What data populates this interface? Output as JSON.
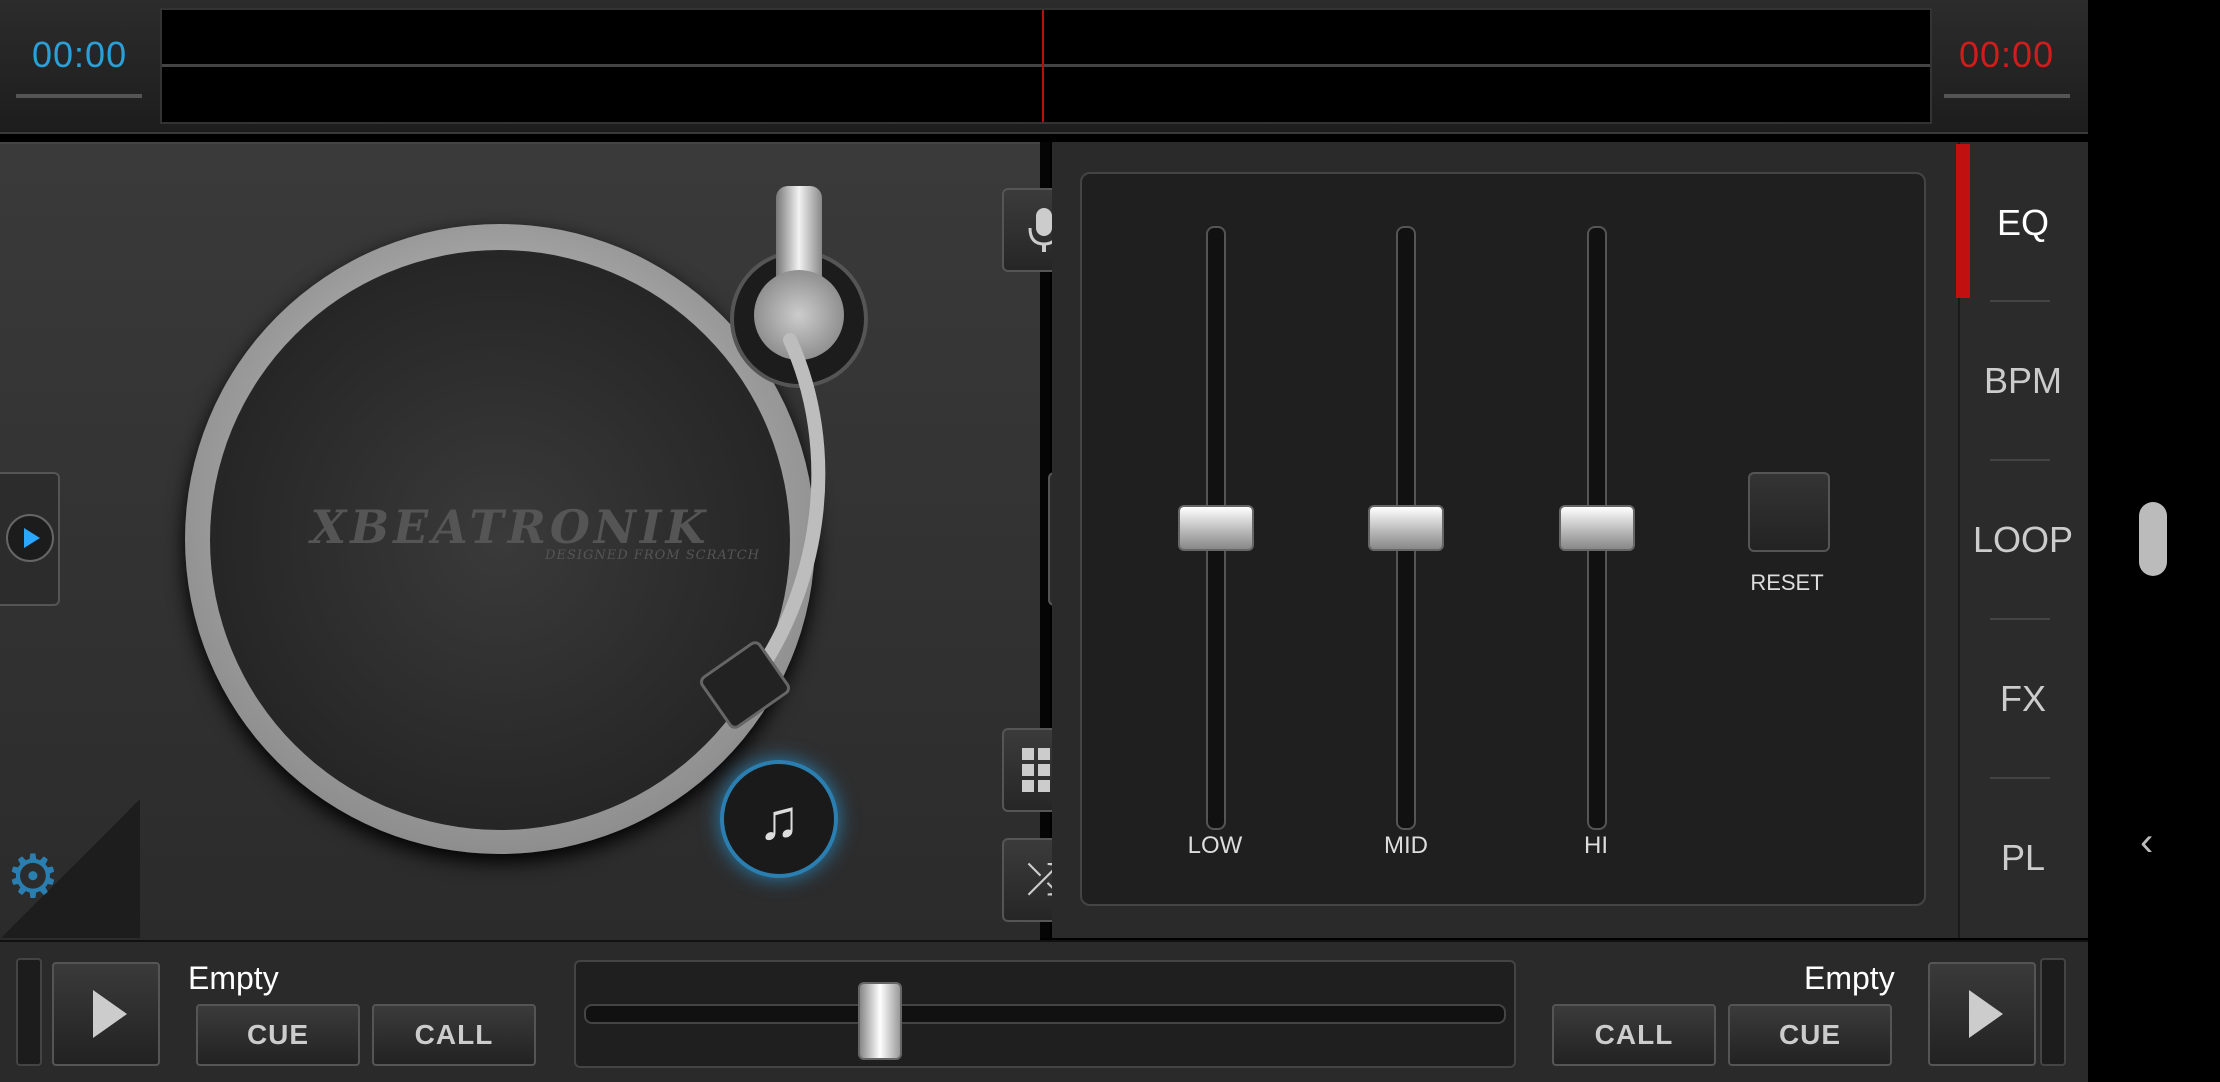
{
  "top": {
    "left_time": "00:00",
    "right_time": "00:00"
  },
  "deck": {
    "logo": "XBEATRONIK",
    "logo_subtitle": "DESIGNED FROM SCRATCH",
    "icons": {
      "settings": "gear-icon",
      "music_add": "music-add-icon",
      "play": "play-icon"
    }
  },
  "middle": {
    "buttons": [
      "microphone-icon",
      "grid-icon",
      "shuffle-icon"
    ]
  },
  "eq": {
    "sliders": [
      {
        "label": "LOW",
        "level": 0.5
      },
      {
        "label": "MID",
        "level": 0.5
      },
      {
        "label": "HI",
        "level": 0.5
      }
    ],
    "reset_label": "RESET"
  },
  "tabs": [
    {
      "label": "EQ",
      "active": true
    },
    {
      "label": "BPM",
      "active": false
    },
    {
      "label": "LOOP",
      "active": false
    },
    {
      "label": "FX",
      "active": false
    },
    {
      "label": "PL",
      "active": false
    }
  ],
  "bottom": {
    "left_track": "Empty",
    "right_track": "Empty",
    "left_buttons": [
      "CUE",
      "CALL"
    ],
    "right_buttons": [
      "CALL",
      "CUE"
    ],
    "crossfader_position": 0.31
  },
  "accent_colors": {
    "blue": "#2a9fd8",
    "red": "#d11c1c"
  }
}
